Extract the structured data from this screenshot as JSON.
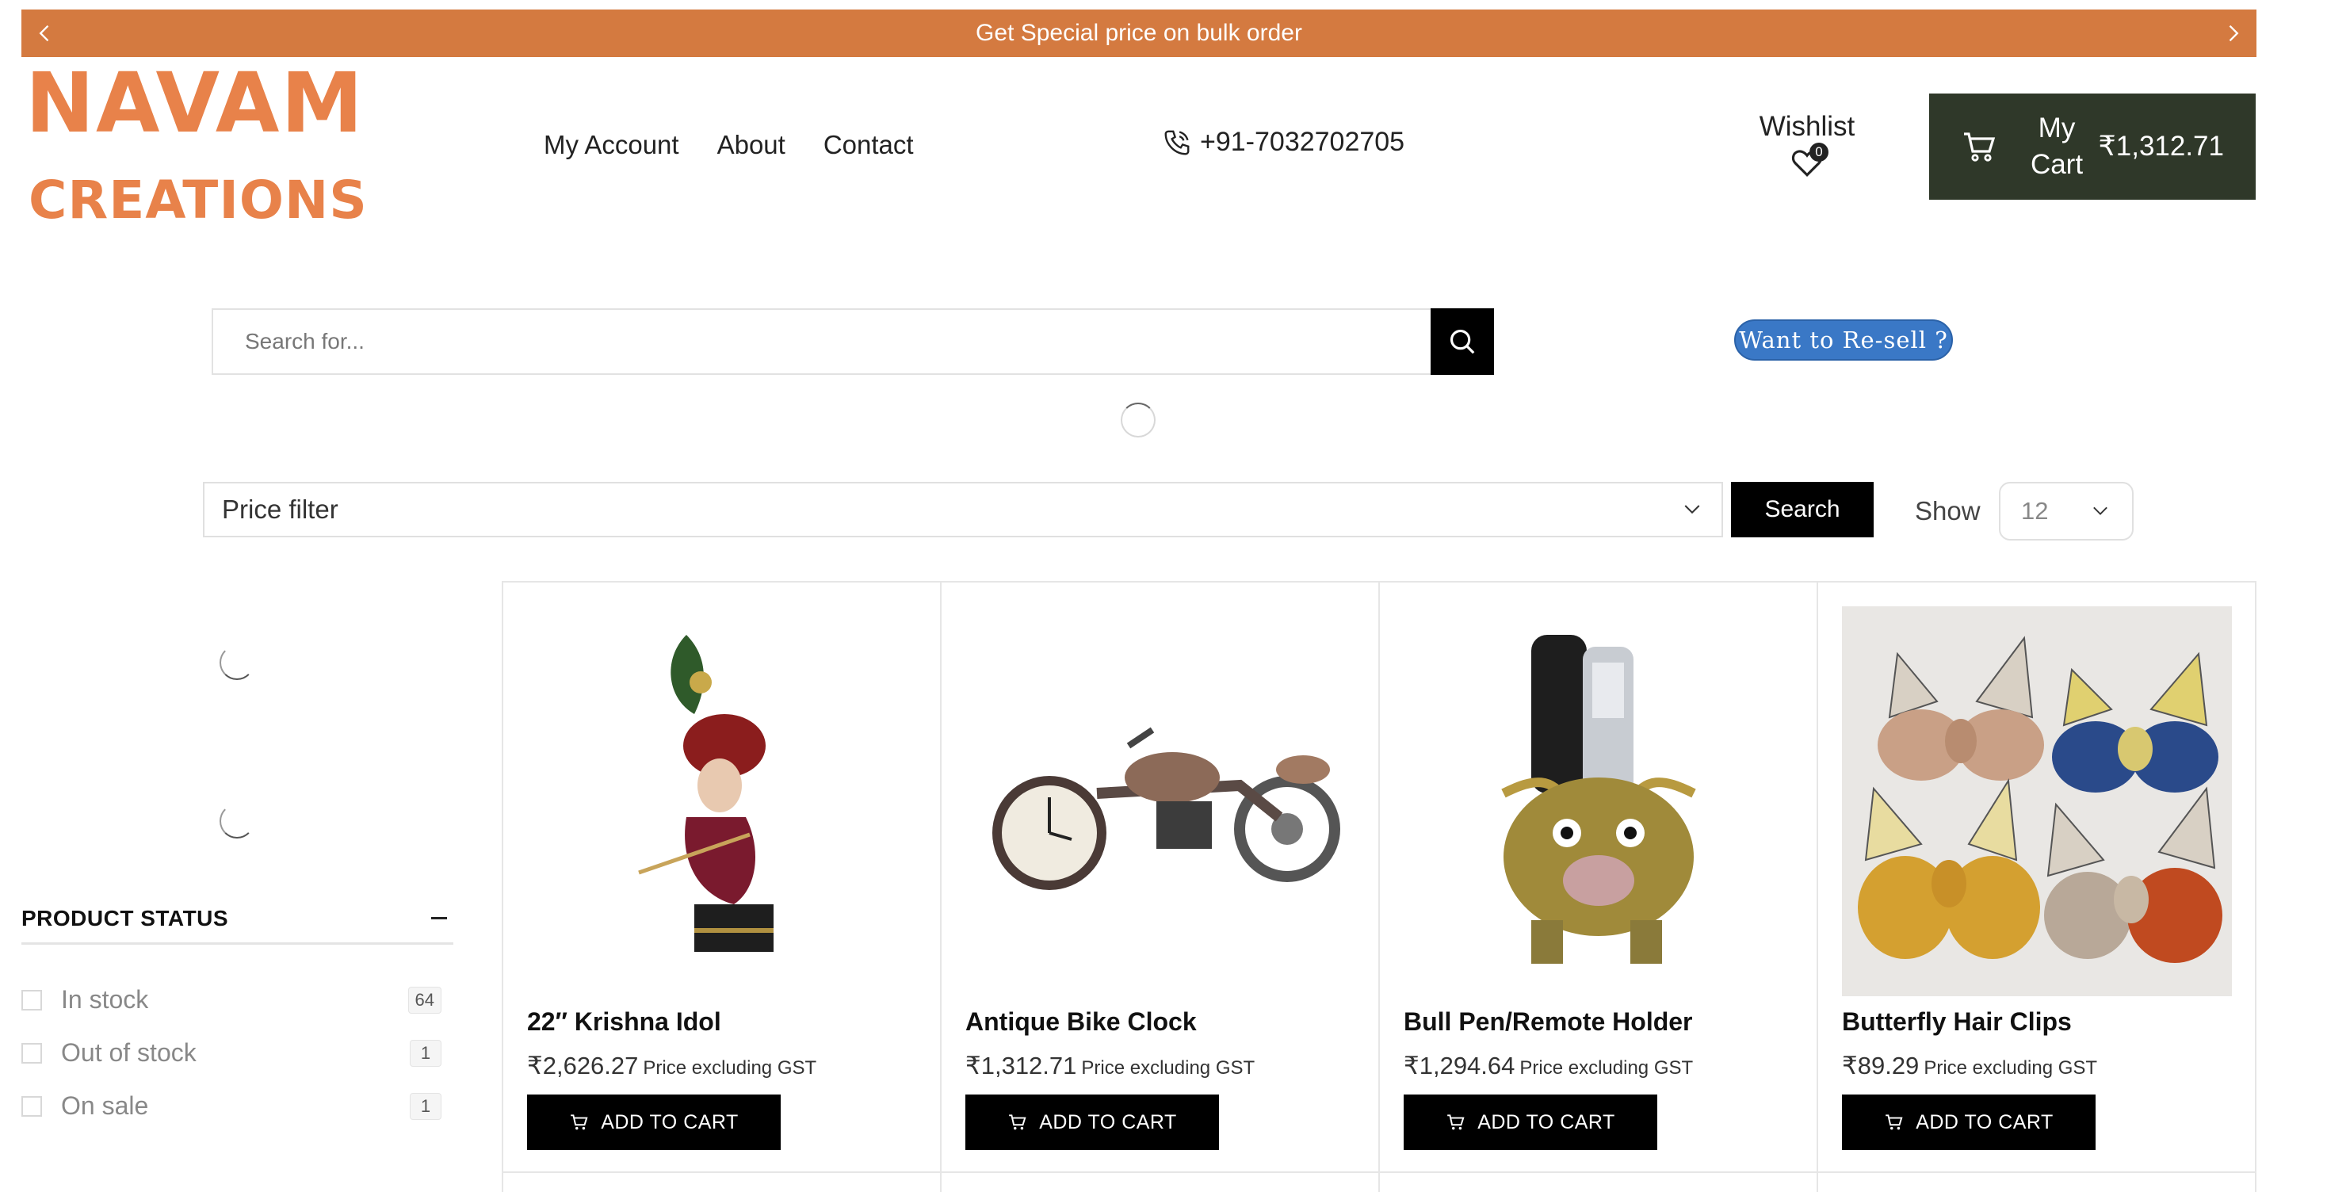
{
  "promo": {
    "text": "Get Special price on bulk order"
  },
  "logo": {
    "line1": "NAVAM",
    "line2": "CREATIONS",
    "color": "#e8824a"
  },
  "nav": {
    "items": [
      "My Account",
      "About",
      "Contact"
    ]
  },
  "phone": {
    "number": "+91-7032702705",
    "icon": "phone-icon"
  },
  "wishlist": {
    "label": "Wishlist",
    "count": "0",
    "icon": "heart-icon"
  },
  "cart": {
    "label": "My Cart",
    "total": "₹1,312.71",
    "icon": "cart-icon",
    "bg": "#2f3829"
  },
  "search": {
    "placeholder": "Search for...",
    "icon": "search-icon"
  },
  "resell": {
    "label": "Want to Re-sell ?",
    "color": "#3a78c6"
  },
  "filter": {
    "placeholder": "Price filter",
    "search_label": "Search",
    "show_label": "Show",
    "show_value": "12"
  },
  "sidebar": {
    "status_title": "PRODUCT STATUS",
    "items": [
      {
        "label": "In stock",
        "count": "64"
      },
      {
        "label": "Out of stock",
        "count": "1"
      },
      {
        "label": "On sale",
        "count": "1"
      }
    ]
  },
  "products": [
    {
      "title": "22″ Krishna Idol",
      "price": "₹2,626.27",
      "gst": "Price excluding GST",
      "button": "ADD TO CART"
    },
    {
      "title": "Antique Bike Clock",
      "price": "₹1,312.71",
      "gst": "Price excluding GST",
      "button": "ADD TO CART"
    },
    {
      "title": "Bull Pen/Remote Holder",
      "price": "₹1,294.64",
      "gst": "Price excluding GST",
      "button": "ADD TO CART"
    },
    {
      "title": "Butterfly Hair Clips",
      "price": "₹89.29",
      "gst": "Price excluding GST",
      "button": "ADD TO CART"
    }
  ]
}
